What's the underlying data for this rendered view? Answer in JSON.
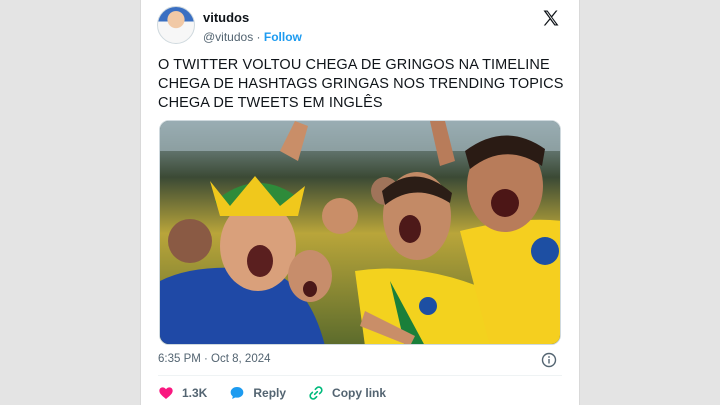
{
  "tweet": {
    "display_name": "vitudos",
    "handle": "@vitudos",
    "separator": "·",
    "follow_label": "Follow",
    "text_lines": [
      "O TWITTER VOLTOU CHEGA DE GRINGOS NA TIMELINE",
      "CHEGA DE HASHTAGS GRINGAS NOS TRENDING TOPICS",
      "CHEGA DE TWEETS EM INGLÊS"
    ],
    "timestamp": "6:35 PM · Oct 8, 2024",
    "likes": "1.3K",
    "reply_label": "Reply",
    "copy_link_label": "Copy link"
  },
  "icons": {
    "brand": "x-logo-icon",
    "info": "info-icon",
    "like": "heart-icon",
    "reply": "reply-bubble-icon",
    "copy": "link-icon"
  },
  "colors": {
    "link": "#1d9bf0",
    "like": "#f91880",
    "reply": "#1d9bf0",
    "copy": "#00ba7c",
    "muted": "#536471"
  }
}
